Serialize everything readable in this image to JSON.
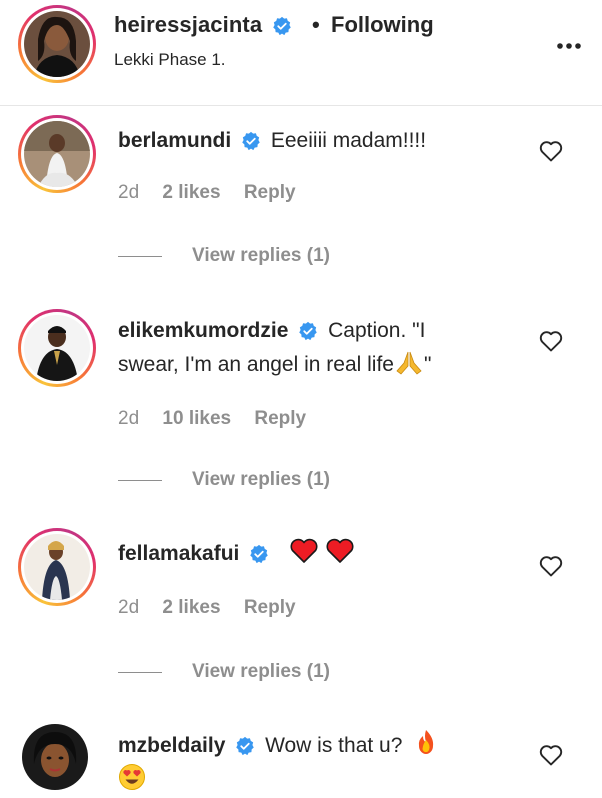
{
  "header": {
    "username": "heiressjacinta",
    "separator": "•",
    "follow_label": "Following",
    "location": "Lekki Phase 1.",
    "more_icon": "more-horizontal-icon"
  },
  "comments": [
    {
      "username": "berlamundi",
      "text": "Eeeiiii madam!!!!",
      "time": "2d",
      "likes": "2 likes",
      "reply": "Reply",
      "view_replies": "View replies (1)"
    },
    {
      "username": "elikemkumordzie",
      "text": "Caption. \"I swear, I'm an angel in real life🙏\"",
      "text_line1": "Caption. \"I",
      "text_line2": "swear, I'm an angel in real life",
      "text_end": "\"",
      "time": "2d",
      "likes": "10 likes",
      "reply": "Reply",
      "view_replies": "View replies (1)"
    },
    {
      "username": "fellamakafui",
      "text": "❤️❤️",
      "time": "2d",
      "likes": "2 likes",
      "reply": "Reply",
      "view_replies": "View replies (1)"
    },
    {
      "username": "mzbeldaily",
      "text": "Wow is that u?",
      "emoji_1": "fire-emoji",
      "emoji_2": "heart-eyes-emoji"
    }
  ],
  "colors": {
    "verified": "#3897f0",
    "text": "#262626",
    "meta": "#8e8e8e",
    "heart_red": "#ed1c24"
  }
}
